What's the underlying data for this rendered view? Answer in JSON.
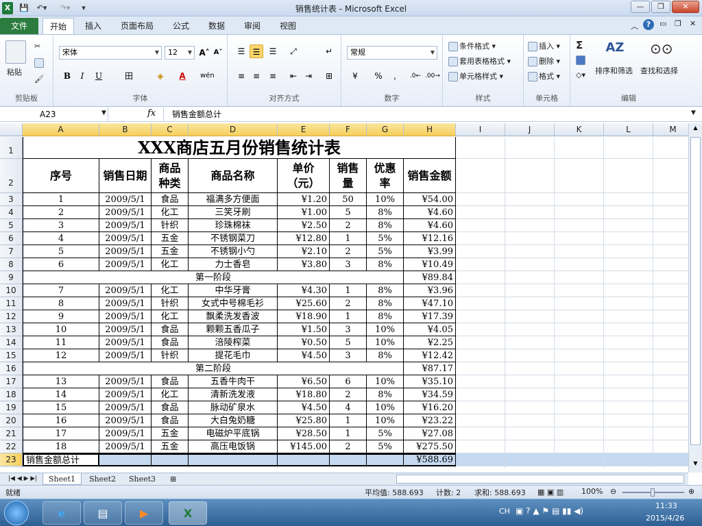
{
  "window": {
    "title": "销售统计表 - Microsoft Excel"
  },
  "tabs": [
    "文件",
    "开始",
    "插入",
    "页面布局",
    "公式",
    "数据",
    "审阅",
    "视图"
  ],
  "ribbon": {
    "clipboard": {
      "label": "剪贴板",
      "paste": "粘贴"
    },
    "font": {
      "label": "字体",
      "name": "宋体",
      "size": "12"
    },
    "align": {
      "label": "对齐方式"
    },
    "number": {
      "label": "数字",
      "format": "常规",
      "percent": "%",
      "comma": ","
    },
    "styles": {
      "label": "样式",
      "conditional": "条件格式",
      "table": "套用表格格式",
      "cell": "单元格样式"
    },
    "cells": {
      "label": "单元格",
      "insert": "插入",
      "delete": "删除",
      "format": "格式"
    },
    "editing": {
      "label": "编辑",
      "sum": "Σ",
      "sort": "排序和筛选",
      "find": "查找和选择"
    }
  },
  "formula_bar": {
    "name_box": "A23",
    "fx": "fx",
    "content": "销售金额总计"
  },
  "columns": [
    "A",
    "B",
    "C",
    "D",
    "E",
    "F",
    "G",
    "H",
    "I",
    "J",
    "K",
    "L",
    "M"
  ],
  "sheet": {
    "title": "XXX商店五月份销售统计表",
    "headers": [
      "序号",
      "销售日期",
      "商品种类",
      "商品名称",
      "单价（元）",
      "销售量",
      "优惠率",
      "销售金额"
    ],
    "rows": [
      {
        "n": "3",
        "cells": [
          "1",
          "2009/5/1",
          "食品",
          "福满多方便面",
          "¥1.20",
          "50",
          "10%",
          "¥54.00"
        ]
      },
      {
        "n": "4",
        "cells": [
          "2",
          "2009/5/1",
          "化工",
          "三笑牙刷",
          "¥1.00",
          "5",
          "8%",
          "¥4.60"
        ]
      },
      {
        "n": "5",
        "cells": [
          "3",
          "2009/5/1",
          "针织",
          "珍珠棉袜",
          "¥2.50",
          "2",
          "8%",
          "¥4.60"
        ]
      },
      {
        "n": "6",
        "cells": [
          "4",
          "2009/5/1",
          "五金",
          "不锈钢菜刀",
          "¥12.80",
          "1",
          "5%",
          "¥12.16"
        ]
      },
      {
        "n": "7",
        "cells": [
          "5",
          "2009/5/1",
          "五金",
          "不锈钢小勺",
          "¥2.10",
          "2",
          "5%",
          "¥3.99"
        ]
      },
      {
        "n": "8",
        "cells": [
          "6",
          "2009/5/1",
          "化工",
          "力士香皂",
          "¥3.80",
          "3",
          "8%",
          "¥10.49"
        ]
      },
      {
        "n": "9",
        "subtotal": "第一阶段",
        "amount": "¥89.84"
      },
      {
        "n": "10",
        "cells": [
          "7",
          "2009/5/1",
          "化工",
          "中华牙膏",
          "¥4.30",
          "1",
          "8%",
          "¥3.96"
        ]
      },
      {
        "n": "11",
        "cells": [
          "8",
          "2009/5/1",
          "针织",
          "女式中号棉毛衫",
          "¥25.60",
          "2",
          "8%",
          "¥47.10"
        ]
      },
      {
        "n": "12",
        "cells": [
          "9",
          "2009/5/1",
          "化工",
          "飘柔洗发香波",
          "¥18.90",
          "1",
          "8%",
          "¥17.39"
        ]
      },
      {
        "n": "13",
        "cells": [
          "10",
          "2009/5/1",
          "食品",
          "颗颗五香瓜子",
          "¥1.50",
          "3",
          "10%",
          "¥4.05"
        ]
      },
      {
        "n": "14",
        "cells": [
          "11",
          "2009/5/1",
          "食品",
          "涪陵榨菜",
          "¥0.50",
          "5",
          "10%",
          "¥2.25"
        ]
      },
      {
        "n": "15",
        "cells": [
          "12",
          "2009/5/1",
          "针织",
          "提花毛巾",
          "¥4.50",
          "3",
          "8%",
          "¥12.42"
        ]
      },
      {
        "n": "16",
        "subtotal": "第二阶段",
        "amount": "¥87.17"
      },
      {
        "n": "17",
        "cells": [
          "13",
          "2009/5/1",
          "食品",
          "五香牛肉干",
          "¥6.50",
          "6",
          "10%",
          "¥35.10"
        ]
      },
      {
        "n": "18",
        "cells": [
          "14",
          "2009/5/1",
          "化工",
          "清新洗发液",
          "¥18.80",
          "2",
          "8%",
          "¥34.59"
        ]
      },
      {
        "n": "19",
        "cells": [
          "15",
          "2009/5/1",
          "食品",
          "脉动矿泉水",
          "¥4.50",
          "4",
          "10%",
          "¥16.20"
        ]
      },
      {
        "n": "20",
        "cells": [
          "16",
          "2009/5/1",
          "食品",
          "大白兔奶糖",
          "¥25.80",
          "1",
          "10%",
          "¥23.22"
        ]
      },
      {
        "n": "21",
        "cells": [
          "17",
          "2009/5/1",
          "五金",
          "电磁炉平底锅",
          "¥28.50",
          "1",
          "5%",
          "¥27.08"
        ]
      },
      {
        "n": "22",
        "cells": [
          "18",
          "2009/5/1",
          "五金",
          "高压电饭锅",
          "¥145.00",
          "2",
          "5%",
          "¥275.50"
        ]
      },
      {
        "n": "23",
        "total": "销售金额总计",
        "amount": "¥588.69"
      }
    ]
  },
  "sheet_tabs": [
    "Sheet1",
    "Sheet2",
    "Sheet3"
  ],
  "status": {
    "ready": "就绪",
    "average": "平均值: 588.693",
    "count": "计数: 2",
    "sum": "求和: 588.693",
    "zoom": "100%"
  },
  "taskbar": {
    "ime": "CH",
    "time": "11:33",
    "date": "2015/4/26"
  }
}
